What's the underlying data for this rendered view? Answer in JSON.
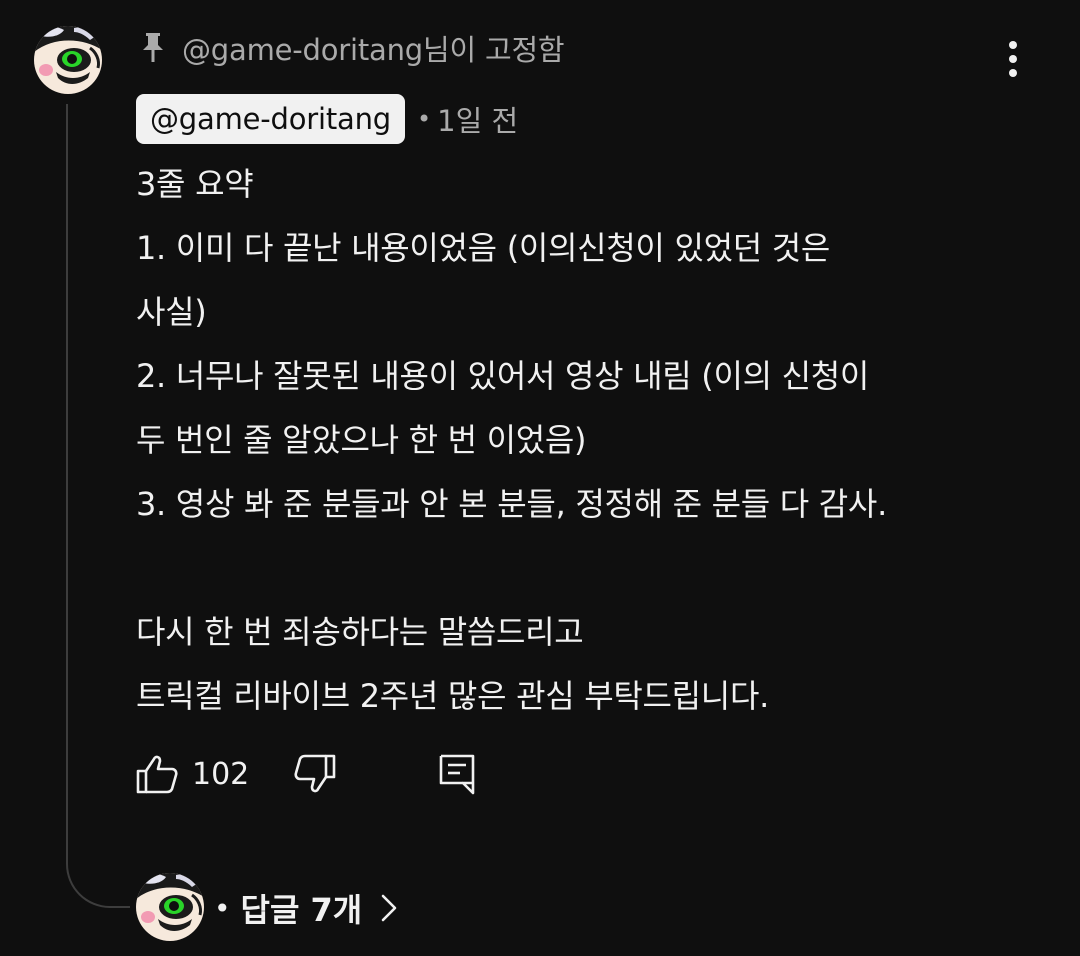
{
  "pinned": {
    "icon": "pin-icon",
    "text": "@game-doritang님이 고정함"
  },
  "comment": {
    "author": "@game-doritang",
    "separator": "•",
    "time": "1일 전",
    "lines": [
      "3줄 요약",
      "1. 이미 다 끝난 내용이었음 (이의신청이 있었던 것은",
      "사실)",
      "2. 너무나 잘못된 내용이 있어서 영상 내림 (이의 신청이",
      "두 번인 줄 알았으나 한 번 이었음)",
      "3. 영상 봐 준 분들과 안 본 분들, 정정해 준 분들 다 감사.",
      "",
      "다시 한 번 죄송하다는 말씀드리고",
      "트릭컬 리바이브 2주년 많은 관심 부탁드립니다."
    ]
  },
  "actions": {
    "like_count": "102",
    "like_icon": "thumbs-up-icon",
    "dislike_icon": "thumbs-down-icon",
    "reply_icon": "reply-comment-icon"
  },
  "replies": {
    "dot": "•",
    "label": "답글 7개",
    "icon": "chevron-right-icon"
  },
  "colors": {
    "background": "#0f0f0f",
    "text_primary": "#f1f1f1",
    "text_secondary": "#aaaaaa",
    "thread_line": "#3d3d3d",
    "avatar_accent": "#2bd62b"
  }
}
